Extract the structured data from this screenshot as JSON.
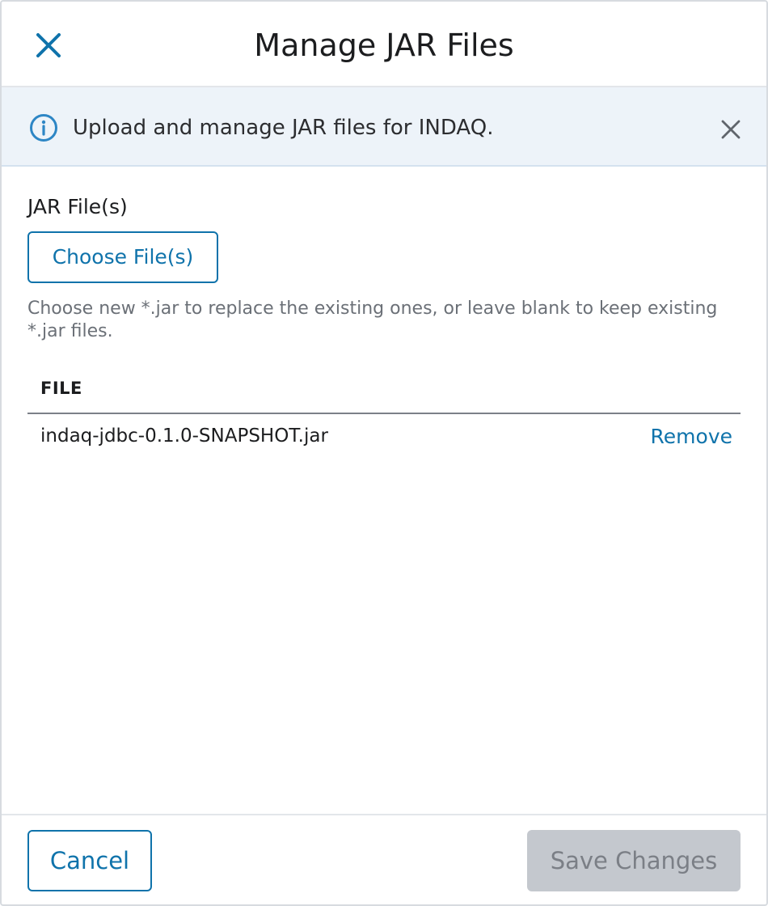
{
  "dialog": {
    "title": "Manage JAR Files",
    "close_icon": "close-icon"
  },
  "banner": {
    "info_icon": "info-icon",
    "text": "Upload and manage JAR files for INDAQ.",
    "dismiss_icon": "close-icon"
  },
  "upload": {
    "label": "JAR File(s)",
    "choose_button": "Choose File(s)",
    "help_text": "Choose new *.jar to replace the existing ones, or leave blank to keep existing *.jar files."
  },
  "table": {
    "columns": [
      "FILE"
    ],
    "rows": [
      {
        "file": "indaq-jdbc-0.1.0-SNAPSHOT.jar",
        "action": "Remove"
      }
    ]
  },
  "footer": {
    "cancel_label": "Cancel",
    "save_label": "Save Changes"
  },
  "colors": {
    "accent": "#0f73ab",
    "banner_bg": "#edf3f9",
    "disabled_bg": "#c4c8ce",
    "disabled_text": "#7b7f86"
  }
}
